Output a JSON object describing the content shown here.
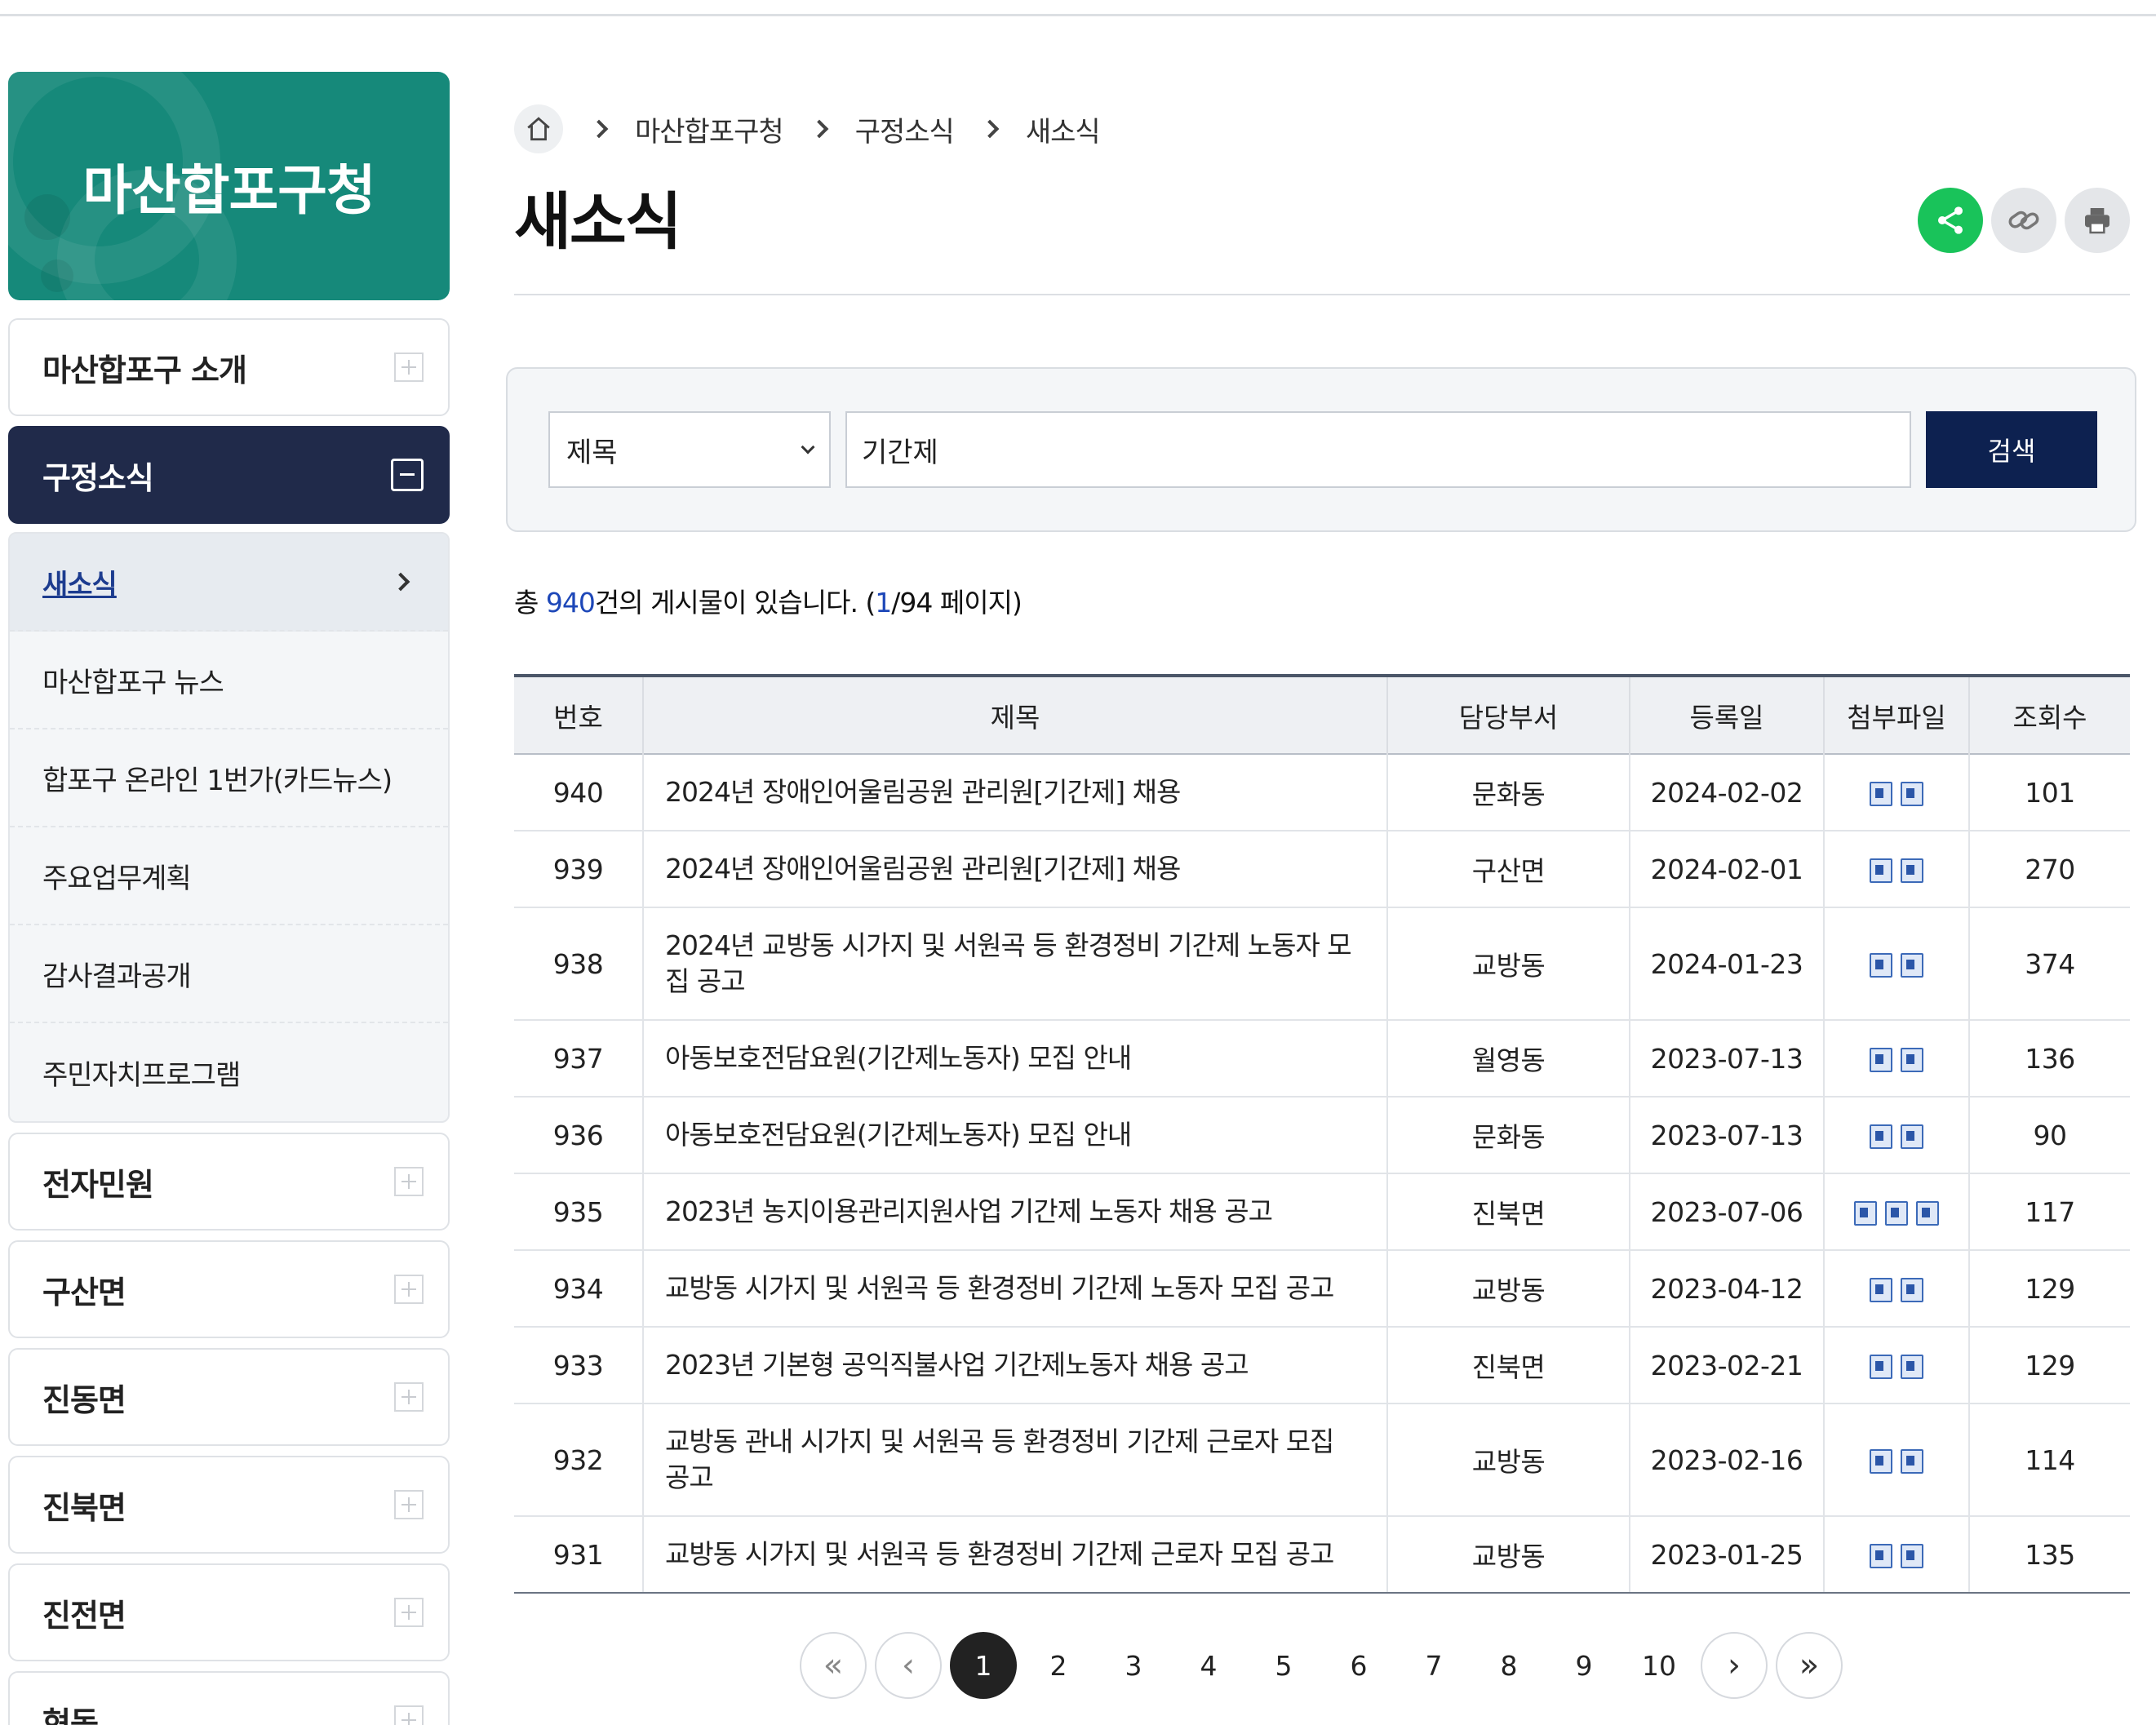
{
  "sidebar": {
    "brand": "마산합포구청",
    "top_menu": [
      {
        "label": "마산합포구 소개"
      }
    ],
    "active_menu": {
      "label": "구정소식"
    },
    "submenu": [
      {
        "label": "새소식"
      },
      {
        "label": "마산합포구 뉴스"
      },
      {
        "label": "합포구 온라인 1번가(카드뉴스)"
      },
      {
        "label": "주요업무계획"
      },
      {
        "label": "감사결과공개"
      },
      {
        "label": "주민자치프로그램"
      }
    ],
    "bottom_menu": [
      {
        "label": "전자민원"
      },
      {
        "label": "구산면"
      },
      {
        "label": "진동면"
      },
      {
        "label": "진북면"
      },
      {
        "label": "진전면"
      },
      {
        "label": "현동"
      }
    ]
  },
  "breadcrumb": [
    "마산합포구청",
    "구정소식",
    "새소식"
  ],
  "page_title": "새소식",
  "icons": {
    "home": "home-icon",
    "share": "share-icon",
    "link": "link-icon",
    "print": "print-icon",
    "attachment": "attachment-file-icon"
  },
  "colors": {
    "brand": "#16897a",
    "nav_active": "#202a4a",
    "search_button": "#0d2150",
    "share": "#19c35a",
    "count_highlight": "#1d47b8"
  },
  "search": {
    "field_selected": "제목",
    "keyword": "기간제",
    "button": "검색"
  },
  "summary": {
    "prefix": "총 ",
    "total": "940",
    "middle": "건의 게시물이 있습니다. (",
    "current_page": "1",
    "suffix": "/94 페이지)"
  },
  "table": {
    "columns": [
      "번호",
      "제목",
      "담당부서",
      "등록일",
      "첨부파일",
      "조회수"
    ],
    "rows": [
      {
        "no": "940",
        "title": "2024년 장애인어울림공원 관리원[기간제] 채용",
        "dept": "문화동",
        "date": "2024-02-02",
        "files": 2,
        "views": "101"
      },
      {
        "no": "939",
        "title": "2024년 장애인어울림공원 관리원[기간제] 채용",
        "dept": "구산면",
        "date": "2024-02-01",
        "files": 2,
        "views": "270"
      },
      {
        "no": "938",
        "title": "2024년 교방동 시가지 및 서원곡 등 환경정비 기간제 노동자 모집 공고",
        "dept": "교방동",
        "date": "2024-01-23",
        "files": 2,
        "views": "374"
      },
      {
        "no": "937",
        "title": "아동보호전담요원(기간제노동자) 모집 안내",
        "dept": "월영동",
        "date": "2023-07-13",
        "files": 2,
        "views": "136"
      },
      {
        "no": "936",
        "title": "아동보호전담요원(기간제노동자) 모집 안내",
        "dept": "문화동",
        "date": "2023-07-13",
        "files": 2,
        "views": "90"
      },
      {
        "no": "935",
        "title": "2023년 농지이용관리지원사업 기간제 노동자 채용 공고",
        "dept": "진북면",
        "date": "2023-07-06",
        "files": 3,
        "views": "117"
      },
      {
        "no": "934",
        "title": "교방동 시가지 및 서원곡 등 환경정비 기간제 노동자 모집 공고",
        "dept": "교방동",
        "date": "2023-04-12",
        "files": 2,
        "views": "129"
      },
      {
        "no": "933",
        "title": "2023년 기본형 공익직불사업 기간제노동자 채용 공고",
        "dept": "진북면",
        "date": "2023-02-21",
        "files": 2,
        "views": "129"
      },
      {
        "no": "932",
        "title": "교방동 관내 시가지 및 서원곡 등 환경정비 기간제 근로자 모집 공고",
        "dept": "교방동",
        "date": "2023-02-16",
        "files": 2,
        "views": "114"
      },
      {
        "no": "931",
        "title": "교방동 시가지 및 서원곡 등 환경정비 기간제 근로자 모집 공고",
        "dept": "교방동",
        "date": "2023-01-25",
        "files": 2,
        "views": "135"
      }
    ]
  },
  "pagination": {
    "pages": [
      "1",
      "2",
      "3",
      "4",
      "5",
      "6",
      "7",
      "8",
      "9",
      "10"
    ],
    "current": "1",
    "first": "«",
    "prev": "‹",
    "next": "›",
    "last": "»"
  }
}
